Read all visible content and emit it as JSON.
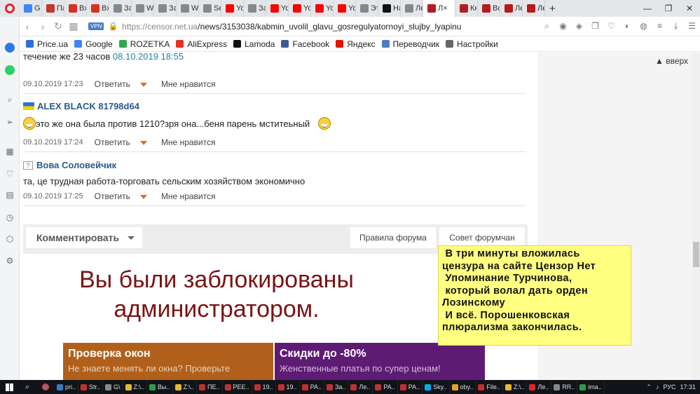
{
  "browser": {
    "tabs": [
      {
        "label": "G из",
        "color": "#4285f4"
      },
      {
        "label": "Па",
        "color": "#c0392b"
      },
      {
        "label": "Вх",
        "color": "#d93025"
      },
      {
        "label": "Вх",
        "color": "#d93025"
      },
      {
        "label": "За",
        "color": "#888888"
      },
      {
        "label": "Wi",
        "color": "#888888"
      },
      {
        "label": "За",
        "color": "#888888"
      },
      {
        "label": "W",
        "color": "#888888"
      },
      {
        "label": "Se",
        "color": "#888888"
      },
      {
        "label": "Yo",
        "color": "#ff0000"
      },
      {
        "label": "За",
        "color": "#888888"
      },
      {
        "label": "Yo",
        "color": "#ff0000"
      },
      {
        "label": "Yo",
        "color": "#ff0000"
      },
      {
        "label": "Yo",
        "color": "#ff0000"
      },
      {
        "label": "Yo",
        "color": "#ff0000"
      },
      {
        "label": "Эт",
        "color": "#888888"
      },
      {
        "label": "На",
        "color": "#111111"
      },
      {
        "label": "Ле",
        "color": "#888888"
      },
      {
        "label": "Л",
        "color": "#b71c1c"
      },
      {
        "label": "Кн",
        "color": "#b71c1c"
      },
      {
        "label": "Вс",
        "color": "#b71c1c"
      },
      {
        "label": "Ле",
        "color": "#b71c1c"
      },
      {
        "label": "Ле",
        "color": "#b71c1c"
      }
    ],
    "active_tab_index": 18,
    "new_tab": "+",
    "url_host": "https://censor.net.ua",
    "url_path": "/news/3153038/kabmin_uvolil_glavu_gosregulyatornoyi_slujby_lyapinu",
    "vpn_label": "VPN",
    "bookmarks": [
      {
        "label": "Price.ua",
        "color": "#2e6fd6"
      },
      {
        "label": "Google",
        "color": "#4285f4"
      },
      {
        "label": "ROZETKA",
        "color": "#2eaa4a"
      },
      {
        "label": "AliExpress",
        "color": "#e43225"
      },
      {
        "label": "Lamoda",
        "color": "#111111"
      },
      {
        "label": "Facebook",
        "color": "#3b5998"
      },
      {
        "label": "Яндекс",
        "color": "#e61400"
      },
      {
        "label": "Переводчик",
        "color": "#4a7fc1"
      },
      {
        "label": "Настройки",
        "color": "#666666"
      }
    ]
  },
  "page": {
    "to_top": "вверх",
    "comment_tail": {
      "text": "течение же 23 часов ",
      "date": "08.10.2019 18:55"
    },
    "comments": [
      {
        "date": "09.10.2019 17:23",
        "reply": "Ответить",
        "dislike": "Мне нравится"
      },
      {
        "author": "ALEX BLACK 81798d64",
        "text": "это же она была против 1210?зря она...беня парень мститеьный",
        "date": "09.10.2019 17:24",
        "reply": "Ответить",
        "dislike": "Мне нравится"
      },
      {
        "author": "Вова Соловейчик",
        "text": "та, це трудная работа-торговать сельским хозяйством экономично",
        "date": "09.10.2019 17:25",
        "reply": "Ответить",
        "dislike": "Мне нравится"
      }
    ],
    "comment_button": "Комментировать",
    "rules_button": "Правила форума",
    "advice_button": "Совет форумчан",
    "blocked_message": "Вы были заблокированы администратором.",
    "ads": [
      {
        "title": "Проверка окон",
        "subtitle": "Не знаете менять ли окна? Проверьте"
      },
      {
        "title": "Скидки до -80%",
        "subtitle": "Женственные платья по супер ценам!"
      }
    ],
    "note": " В три минуты вложилась\nцензура на сайте Цензор Нет\n Упоминание Турчинова,\n который волал дать орден\nЛозинскому\n И всё. Порошенковская\nплюрализма закончилась."
  },
  "taskbar": {
    "items": [
      {
        "label": "pri..",
        "color": "#3a78c8"
      },
      {
        "label": "Str..",
        "color": "#c03030"
      },
      {
        "label": "G\\",
        "color": "#888888"
      },
      {
        "label": "Z:\\..",
        "color": "#e8b830"
      },
      {
        "label": "Вы..",
        "color": "#2e9a4a"
      },
      {
        "label": "Z:\\..",
        "color": "#e8b830"
      },
      {
        "label": "ПЕ..",
        "color": "#c03030"
      },
      {
        "label": "РЕЕ..",
        "color": "#c03030"
      },
      {
        "label": "19..",
        "color": "#c03030"
      },
      {
        "label": "19..",
        "color": "#c03030"
      },
      {
        "label": "РА..",
        "color": "#c03030"
      },
      {
        "label": "За..",
        "color": "#c03030"
      },
      {
        "label": "Ле..",
        "color": "#c03030"
      },
      {
        "label": "РА..",
        "color": "#c03030"
      },
      {
        "label": "РА..",
        "color": "#c03030"
      },
      {
        "label": "Sky..",
        "color": "#00aff0"
      },
      {
        "label": "oby..",
        "color": "#e8a020"
      },
      {
        "label": "File..",
        "color": "#c03030"
      },
      {
        "label": "Z:\\..",
        "color": "#e8b830"
      },
      {
        "label": "Ле..",
        "color": "#e0242f"
      },
      {
        "label": "RR..",
        "color": "#888888"
      },
      {
        "label": "ima..",
        "color": "#2e9a4a"
      }
    ],
    "lang": "РУС",
    "time": "17:31"
  }
}
